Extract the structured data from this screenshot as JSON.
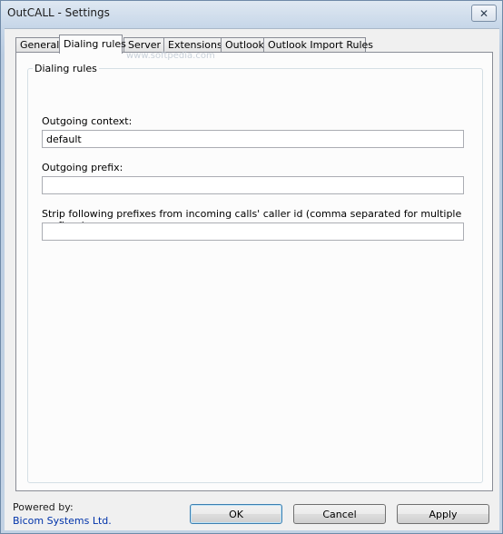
{
  "window": {
    "title": "OutCALL - Settings",
    "close_glyph": "✕"
  },
  "tabs": [
    {
      "label": "General"
    },
    {
      "label": "Dialing rules",
      "active": true
    },
    {
      "label": "Server"
    },
    {
      "label": "Extensions"
    },
    {
      "label": "Outlook"
    },
    {
      "label": "Outlook Import Rules"
    }
  ],
  "watermark": "www.softpedia.com",
  "group": {
    "title": "Dialing rules"
  },
  "fields": {
    "outgoing_context": {
      "label": "Outgoing context:",
      "value": "default"
    },
    "outgoing_prefix": {
      "label": "Outgoing prefix:",
      "value": ""
    },
    "strip_prefixes": {
      "label": "Strip following prefixes from incoming calls' caller id (comma separated for multiple prefixes):",
      "value": ""
    }
  },
  "footer": {
    "powered_by": "Powered by:",
    "company": "Bicom Systems Ltd."
  },
  "buttons": {
    "ok": "OK",
    "cancel": "Cancel",
    "apply": "Apply"
  },
  "colors": {
    "link": "#0033aa",
    "titlebar": "#c6d6e8"
  }
}
